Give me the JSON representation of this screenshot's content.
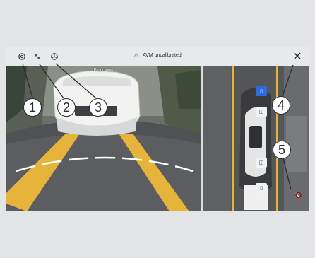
{
  "topbar": {
    "status_text": "AVM uncalibrated",
    "warning_glyph": "⚠",
    "close_glyph": "✕",
    "buttons": [
      {
        "name": "settings-icon"
      },
      {
        "name": "collapse-arrows-icon"
      },
      {
        "name": "wheel-icon"
      }
    ]
  },
  "front_view": {
    "label": "Front view"
  },
  "birdseye": {
    "camera_buttons": [
      {
        "name": "front-camera-button",
        "active": true
      },
      {
        "name": "left-right-front-camera-button",
        "active": false
      },
      {
        "name": "left-right-rear-camera-button",
        "active": false
      },
      {
        "name": "rear-camera-button",
        "active": false
      }
    ],
    "mute_glyph": "🔇"
  },
  "callouts": [
    "1",
    "2",
    "3",
    "4",
    "5"
  ],
  "colors": {
    "lane_yellow": "#e6b43a",
    "active_blue": "#2d6be0",
    "callout_border": "#2b2d31"
  }
}
